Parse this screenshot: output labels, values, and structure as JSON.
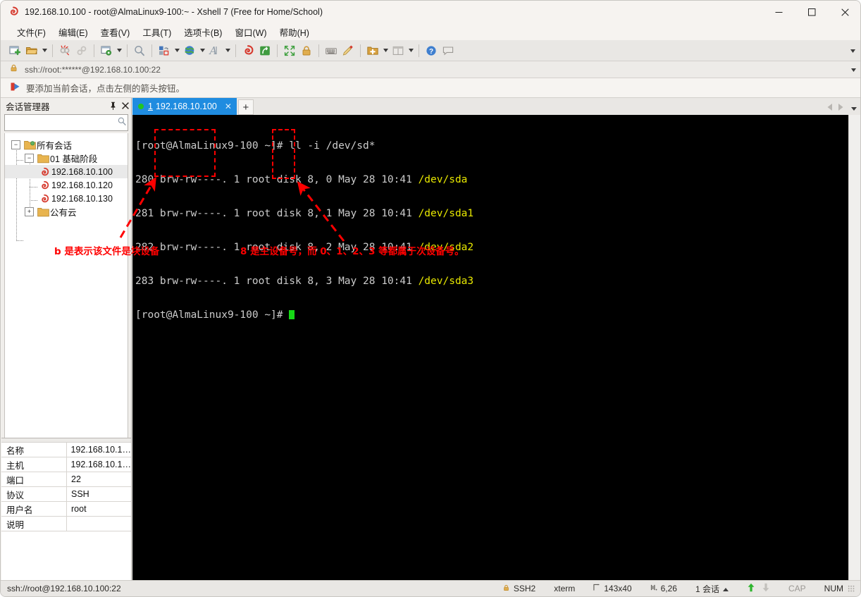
{
  "window": {
    "title": "192.168.10.100 - root@AlmaLinux9-100:~ - Xshell 7 (Free for Home/School)",
    "minimize_label": "—",
    "maximize_label": "□",
    "close_label": "✕"
  },
  "menu": {
    "items": [
      {
        "label": "文件(F)"
      },
      {
        "label": "编辑(E)"
      },
      {
        "label": "查看(V)"
      },
      {
        "label": "工具(T)"
      },
      {
        "label": "选项卡(B)"
      },
      {
        "label": "窗口(W)"
      },
      {
        "label": "帮助(H)"
      }
    ]
  },
  "toolbar": {
    "overflow_label": "▼",
    "buttons": [
      {
        "name": "new-session-icon",
        "caret": false
      },
      {
        "name": "open-folder-icon",
        "caret": true
      },
      {
        "sep": true
      },
      {
        "name": "disconnect-icon",
        "caret": false
      },
      {
        "name": "reconnect-icon",
        "caret": false
      },
      {
        "sep": true
      },
      {
        "name": "session-properties-icon",
        "caret": true
      },
      {
        "sep": true
      },
      {
        "name": "find-icon",
        "caret": false
      },
      {
        "sep": true
      },
      {
        "name": "layout-icon",
        "caret": true
      },
      {
        "name": "globe-icon",
        "caret": true
      },
      {
        "name": "font-icon",
        "caret": true
      },
      {
        "sep": true
      },
      {
        "name": "xshell-icon",
        "caret": false
      },
      {
        "name": "xftp-icon",
        "caret": false
      },
      {
        "sep": true
      },
      {
        "name": "fullscreen-icon",
        "caret": false
      },
      {
        "name": "lock-icon",
        "caret": false
      },
      {
        "sep": true
      },
      {
        "name": "keyboard-icon",
        "caret": false
      },
      {
        "name": "highlight-icon",
        "caret": false
      },
      {
        "sep": true
      },
      {
        "name": "add-panel-icon",
        "caret": true
      },
      {
        "name": "split-view-icon",
        "caret": true
      },
      {
        "sep": true
      },
      {
        "name": "help-icon",
        "caret": false
      },
      {
        "name": "feedback-icon",
        "caret": false
      }
    ]
  },
  "address_bar": {
    "value": "ssh://root:******@192.168.10.100:22",
    "caret_label": "▼"
  },
  "notice_bar": {
    "text": "要添加当前会话，点击左侧的箭头按钮。"
  },
  "sidebar": {
    "title": "会话管理器",
    "pin_label": "⚐",
    "close_label": "✕",
    "search_placeholder": "",
    "search_value": "",
    "tree": {
      "root": {
        "label": "所有会话",
        "expander": "−"
      },
      "folder": {
        "label": "01 基础阶段",
        "expander": "−"
      },
      "sessions": [
        {
          "label": "192.168.10.100",
          "selected": true
        },
        {
          "label": "192.168.10.120",
          "selected": false
        },
        {
          "label": "192.168.10.130",
          "selected": false
        }
      ],
      "cloud_folder": {
        "label": "公有云",
        "expander": "+"
      }
    }
  },
  "properties": {
    "rows": [
      {
        "key": "名称",
        "value": "192.168.10.1…"
      },
      {
        "key": "主机",
        "value": "192.168.10.1…"
      },
      {
        "key": "端口",
        "value": "22"
      },
      {
        "key": "协议",
        "value": "SSH"
      },
      {
        "key": "用户名",
        "value": "root"
      },
      {
        "key": "说明",
        "value": ""
      }
    ]
  },
  "tabs": {
    "active": {
      "number": "1",
      "label": "192.168.10.100",
      "close_label": "✕"
    },
    "add_label": "+",
    "nav_prev": "◀",
    "nav_next": "▶",
    "nav_menu": "▼"
  },
  "terminal": {
    "lines": [
      [
        {
          "t": "[root@AlmaLinux9-100 ~]# ll -i /dev/sd*",
          "c": "white"
        }
      ],
      [
        {
          "t": "280 brw-rw----. 1 root disk 8, 0 May 28 10:41 ",
          "c": "white"
        },
        {
          "t": "/dev/sda",
          "c": "yellow"
        }
      ],
      [
        {
          "t": "281 brw-rw----. 1 root disk 8, 1 May 28 10:41 ",
          "c": "white"
        },
        {
          "t": "/dev/sda1",
          "c": "yellow"
        }
      ],
      [
        {
          "t": "282 brw-rw----. 1 root disk 8, 2 May 28 10:41 ",
          "c": "white"
        },
        {
          "t": "/dev/sda2",
          "c": "yellow"
        }
      ],
      [
        {
          "t": "283 brw-rw----. 1 root disk 8, 3 May 28 10:41 ",
          "c": "white"
        },
        {
          "t": "/dev/sda3",
          "c": "yellow"
        }
      ],
      [
        {
          "t": "[root@AlmaLinux9-100 ~]# ",
          "c": "white"
        },
        {
          "cursor": true
        }
      ]
    ]
  },
  "annotations": {
    "color": "#ff0000",
    "note_block_device": "b 是表示该文件是块设备",
    "note_device_number": "8 是主设备号，而 0、1、2、3 等都属于次设备号。"
  },
  "statusbar": {
    "left": "ssh://root@192.168.10.100:22",
    "security": "SSH2",
    "terminal_type": "xterm",
    "size": "143x40",
    "cursor": "6,26",
    "sessions": "1 会话",
    "sessions_caret": "▲",
    "cap": "CAP",
    "num": "NUM"
  }
}
